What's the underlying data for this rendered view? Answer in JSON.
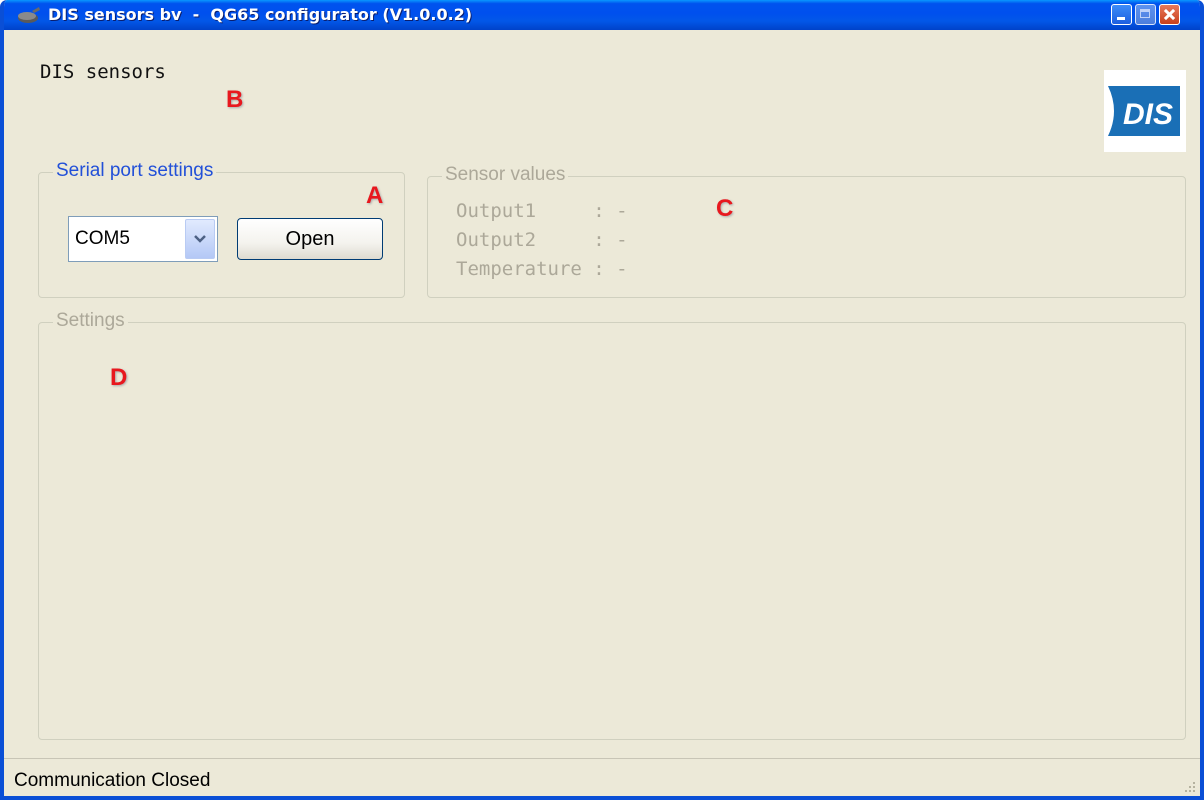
{
  "window": {
    "title": "DIS sensors bv  -  QG65 configurator (V1.0.0.2)"
  },
  "header": {
    "company_label": "DIS sensors",
    "logo_text": "DIS"
  },
  "annotations": {
    "a": "A",
    "b": "B",
    "c": "C",
    "d": "D"
  },
  "serial_port": {
    "legend": "Serial port settings",
    "port_value": "COM5",
    "open_label": "Open"
  },
  "sensor_values": {
    "legend": "Sensor values",
    "lines": [
      "Output1     : -",
      "Output2     : -",
      "Temperature : -"
    ]
  },
  "settings": {
    "legend": "Settings"
  },
  "status": {
    "text": "Communication Closed"
  },
  "colors": {
    "window_border": "#0A4FD6",
    "face": "#ECE9D8",
    "active_legend": "#2250D8",
    "disabled_text": "#ACA899",
    "annotation_red": "#E8181E",
    "logo_blue": "#1A6FB6"
  }
}
